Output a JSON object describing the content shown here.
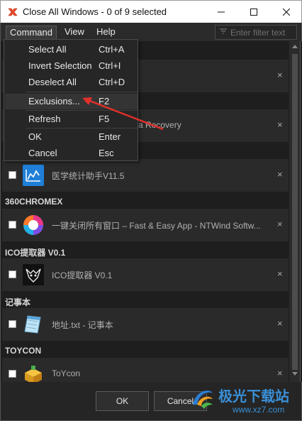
{
  "window": {
    "title": "Close All Windows - 0 of 9 selected",
    "icon": "close-all-windows-app-icon",
    "accent": "#e84a2c"
  },
  "menubar": {
    "items": [
      "Command",
      "View",
      "Help"
    ],
    "filter_placeholder": "Enter filter text"
  },
  "command_menu": {
    "items": [
      {
        "label": "Select All",
        "shortcut": "Ctrl+A"
      },
      {
        "label": "Invert Selection",
        "shortcut": "Ctrl+I"
      },
      {
        "label": "Deselect All",
        "shortcut": "Ctrl+D"
      },
      {
        "label": "Exclusions...",
        "shortcut": "F2"
      },
      {
        "label": "Refresh",
        "shortcut": "F5"
      },
      {
        "label": "OK",
        "shortcut": "Enter"
      },
      {
        "label": "Cancel",
        "shortcut": "Esc"
      }
    ]
  },
  "list": {
    "partial_row_text": "a Recovery",
    "groups": [
      {
        "header": "",
        "rows": [
          {
            "title": "医学统计助手V11.5",
            "icon": "chart-icon"
          }
        ]
      },
      {
        "header": "360CHROMEX",
        "rows": [
          {
            "title": "一键关闭所有窗口 – Fast & Easy App - NTWind Softw...",
            "icon": "colorful-ring-icon"
          }
        ]
      },
      {
        "header": "ICO提取器 V0.1",
        "rows": [
          {
            "title": "ICO提取器 V0.1",
            "icon": "extractor-icon"
          }
        ]
      },
      {
        "header": "记事本",
        "rows": [
          {
            "title": "地址.txt - 记事本",
            "icon": "notepad-icon"
          }
        ]
      },
      {
        "header": "TOYCON",
        "rows": [
          {
            "title": "ToYcon",
            "icon": "toycon-icon"
          }
        ]
      }
    ],
    "close_glyph": "×"
  },
  "footer": {
    "ok_label": "OK",
    "cancel_label": "Cancel"
  },
  "watermark": {
    "name": "极光下载站",
    "url": "www.xz7.com"
  }
}
